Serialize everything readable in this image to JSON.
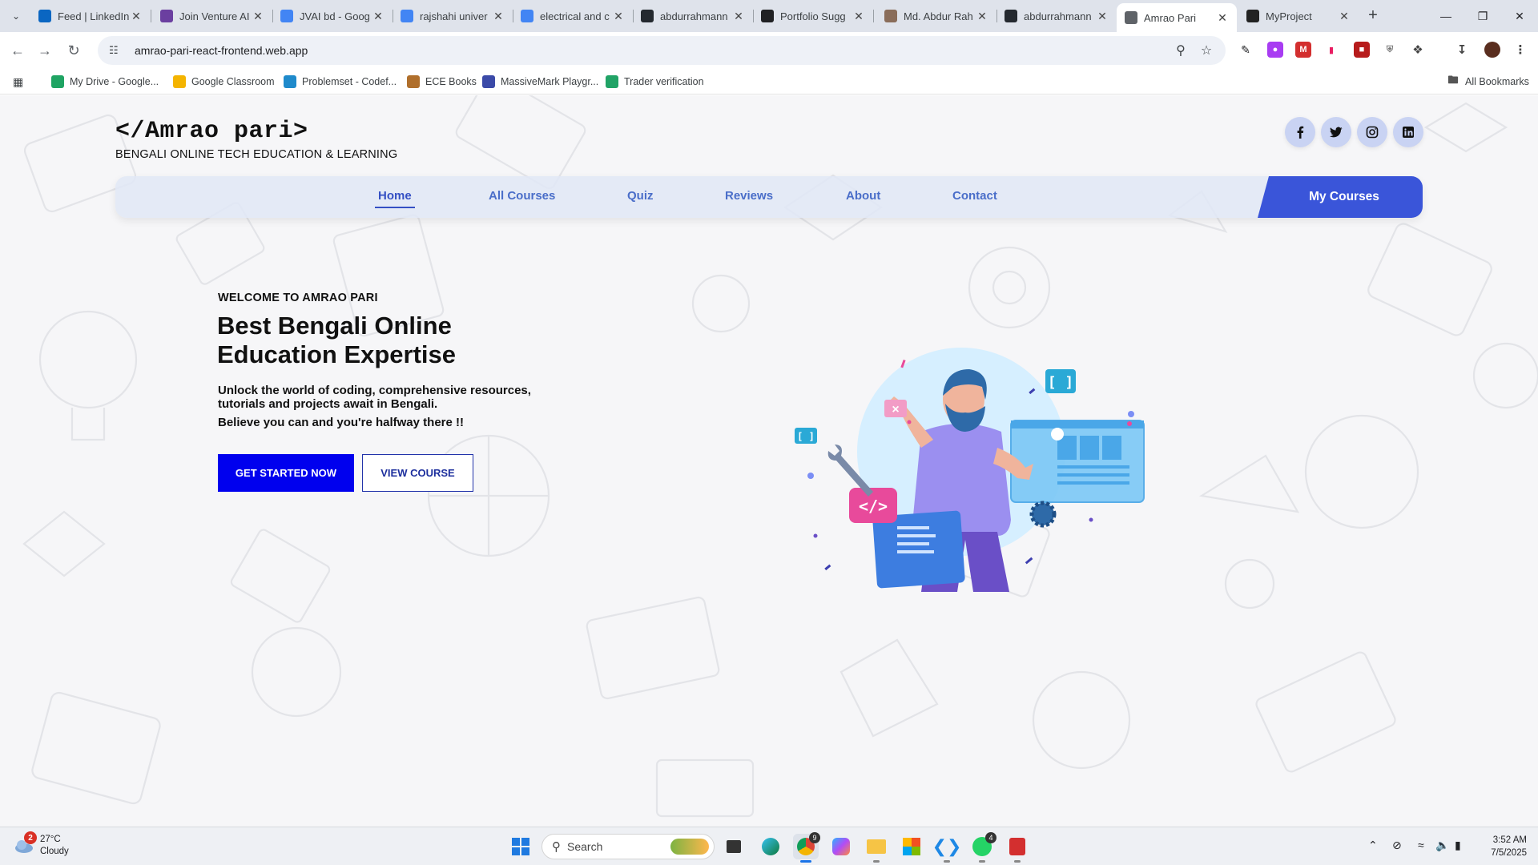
{
  "browser": {
    "tabs": [
      {
        "title": "Feed | LinkedIn",
        "favicon": "linkedin-icon",
        "color": "#0a66c2"
      },
      {
        "title": "Join Venture AI",
        "favicon": "venture-icon",
        "color": "#6b3fa0"
      },
      {
        "title": "JVAI bd - Goog",
        "favicon": "google-icon",
        "color": "#4285f4"
      },
      {
        "title": "rajshahi univer",
        "favicon": "google-icon",
        "color": "#4285f4"
      },
      {
        "title": "electrical and c",
        "favicon": "google-icon",
        "color": "#4285f4"
      },
      {
        "title": "abdurrahmann",
        "favicon": "github-icon",
        "color": "#24292f"
      },
      {
        "title": "Portfolio Sugg",
        "favicon": "chatgpt-icon",
        "color": "#202123"
      },
      {
        "title": "Md. Abdur Rah",
        "favicon": "profile-icon",
        "color": "#8a6d5a"
      },
      {
        "title": "abdurrahmann",
        "favicon": "github-icon",
        "color": "#24292f"
      },
      {
        "title": "Amrao Pari",
        "favicon": "globe-icon",
        "color": "#5f6368"
      },
      {
        "title": "MyProject",
        "favicon": "angular-icon",
        "color": "#222222"
      }
    ],
    "active_tab_index": 9,
    "url": "amrao-pari-react-frontend.web.app",
    "bookmarks": [
      {
        "label": "My Drive - Google...",
        "icon": "drive-icon",
        "color": "#1fa463"
      },
      {
        "label": "Google Classroom",
        "icon": "classroom-icon",
        "color": "#f4b400"
      },
      {
        "label": "Problemset - Codef...",
        "icon": "codeforces-icon",
        "color": "#1f8acb"
      },
      {
        "label": "ECE Books",
        "icon": "books-icon",
        "color": "#b06f2c"
      },
      {
        "label": "MassiveMark Playgr...",
        "icon": "massivemark-icon",
        "color": "#3b4aa8"
      },
      {
        "label": "Trader verification",
        "icon": "trader-icon",
        "color": "#21a366"
      }
    ],
    "all_bookmarks_label": "All Bookmarks"
  },
  "site": {
    "brand": {
      "title": "</Amrao pari>",
      "subtitle": "BENGALI ONLINE TECH EDUCATION & LEARNING"
    },
    "social": [
      "facebook-icon",
      "twitter-icon",
      "instagram-icon",
      "linkedin-icon"
    ],
    "nav": [
      "Home",
      "All Courses",
      "Quiz",
      "Reviews",
      "About",
      "Contact"
    ],
    "active_nav": "Home",
    "cta": "My Courses",
    "hero": {
      "kicker": "WELCOME TO AMRAO PARI",
      "title": "Best Bengali Online Education Expertise",
      "description": "Unlock the world of coding, comprehensive resources, tutorials and projects await in Bengali.",
      "believe": "Believe you can and you're halfway there !!",
      "primary_button": "GET STARTED NOW",
      "secondary_button": "VIEW COURSE"
    },
    "colors": {
      "accent": "#3a55d9",
      "primary_button": "#0000ee",
      "nav_text": "#4a6ec9"
    }
  },
  "taskbar": {
    "weather": {
      "temp": "27°C",
      "condition": "Cloudy",
      "badge": "2"
    },
    "search_placeholder": "Search",
    "time": "3:52 AM",
    "date": "7/5/2025",
    "badges": {
      "chrome": "9",
      "whatsapp": "4"
    }
  }
}
